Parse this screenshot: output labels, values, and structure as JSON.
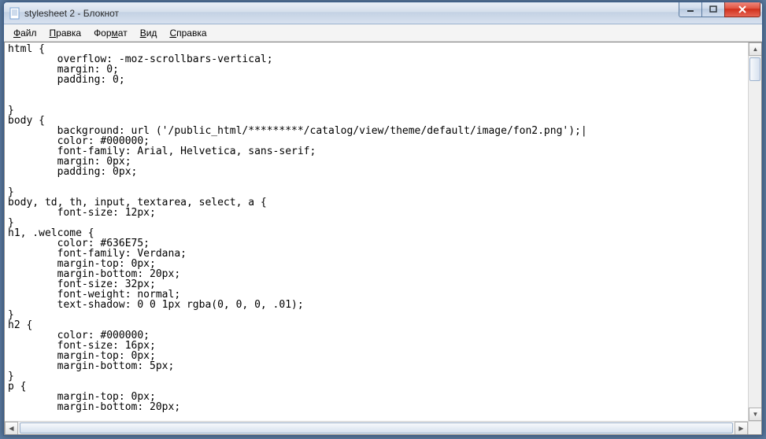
{
  "window": {
    "title": "stylesheet 2 - Блокнот"
  },
  "menu": {
    "file": {
      "label": "Файл",
      "underline_index": 0
    },
    "edit": {
      "label": "Правка",
      "underline_index": 0
    },
    "format": {
      "label": "Формат",
      "underline_index": 3
    },
    "view": {
      "label": "Вид",
      "underline_index": 0
    },
    "help": {
      "label": "Справка",
      "underline_index": 0
    }
  },
  "editor": {
    "content": "html {\n        overflow: -moz-scrollbars-vertical;\n        margin: 0;\n        padding: 0;\n\n\n}\nbody {\n        background: url ('/public_html/*********/catalog/view/theme/default/image/fon2.png');|\n        color: #000000;\n        font-family: Arial, Helvetica, sans-serif;\n        margin: 0px;\n        padding: 0px;\n\n}\nbody, td, th, input, textarea, select, a {\n        font-size: 12px;\n}\nh1, .welcome {\n        color: #636E75;\n        font-family: Verdana;\n        margin-top: 0px;\n        margin-bottom: 20px;\n        font-size: 32px;\n        font-weight: normal;\n        text-shadow: 0 0 1px rgba(0, 0, 0, .01);\n}\nh2 {\n        color: #000000;\n        font-size: 16px;\n        margin-top: 0px;\n        margin-bottom: 5px;\n}\np {\n        margin-top: 0px;\n        margin-bottom: 20px;"
  },
  "icons": {
    "app": "notepad-icon",
    "minimize": "minimize-icon",
    "maximize": "maximize-icon",
    "close": "close-icon",
    "up": "▲",
    "down": "▼",
    "left": "◀",
    "right": "▶"
  }
}
